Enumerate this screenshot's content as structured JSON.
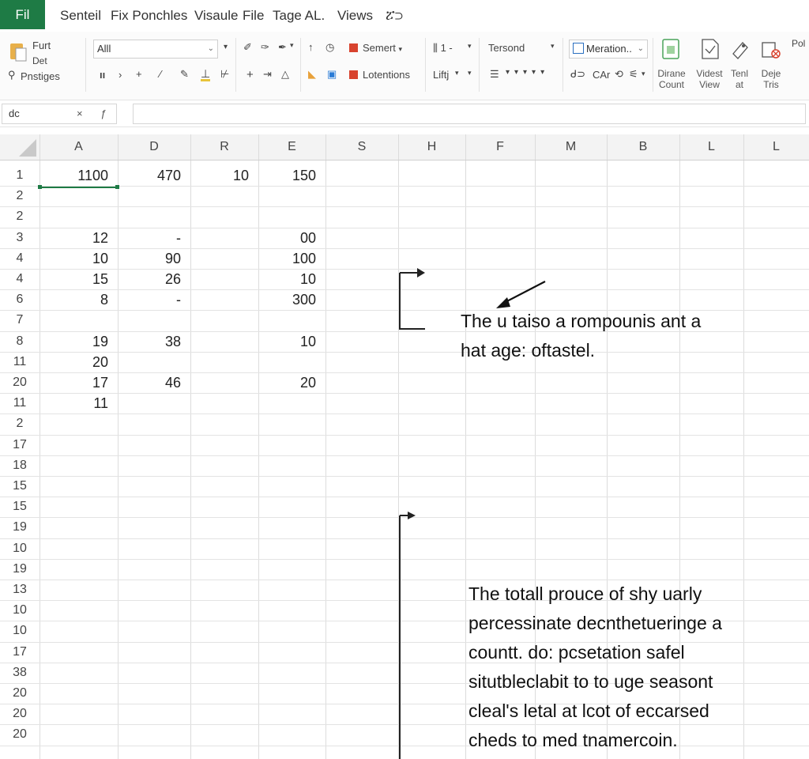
{
  "menu": {
    "file": "Fil",
    "items": [
      "Senteil",
      "Fix Ponchles",
      "Visaule",
      "File",
      "Tage AL.",
      "Views",
      "ፘ⊃"
    ]
  },
  "ribbon": {
    "clipboard": {
      "line1": "Furt",
      "line2": "Det",
      "line3": "Pnstiges"
    },
    "font_combo": "Alll",
    "insert_label": "Semert",
    "lotentions_label": "Lotentions",
    "number_group": {
      "top": "⫼ 1 -",
      "bottom": "Liftj"
    },
    "style_combo": "Tersond",
    "merge_combo": "Meration..",
    "merge_row2": "CAr",
    "right_buttons": [
      {
        "line1": "Dirane",
        "line2": "Count"
      },
      {
        "line1": "Videst",
        "line2": "View"
      },
      {
        "line1": "Tenl",
        "line2": "at"
      },
      {
        "line1": "Deje",
        "line2": "Tris"
      }
    ],
    "far_right": "Pol"
  },
  "formula_bar": {
    "name_box": "dc",
    "cancel": "×",
    "fx": "ƒ"
  },
  "columns": [
    "A",
    "D",
    "R",
    "E",
    "S",
    "H",
    "F",
    "M",
    "B",
    "L",
    "L"
  ],
  "rows": [
    {
      "n": "1",
      "a": "1100",
      "d": "470",
      "r": "10",
      "e": "150"
    },
    {
      "n": "2",
      "a": "",
      "d": "",
      "r": "",
      "e": ""
    },
    {
      "n": "2",
      "a": "",
      "d": "",
      "r": "",
      "e": ""
    },
    {
      "n": "3",
      "a": "12",
      "d": "-",
      "r": "",
      "e": "00"
    },
    {
      "n": "4",
      "a": "10",
      "d": "90",
      "r": "",
      "e": "100"
    },
    {
      "n": "4",
      "a": "15",
      "d": "26",
      "r": "",
      "e": "10"
    },
    {
      "n": "6",
      "a": "8",
      "d": "-",
      "r": "",
      "e": "300"
    },
    {
      "n": "7",
      "a": "",
      "d": "",
      "r": "",
      "e": ""
    },
    {
      "n": "8",
      "a": "19",
      "d": "38",
      "r": "",
      "e": "10"
    },
    {
      "n": "11",
      "a": "20",
      "d": "",
      "r": "",
      "e": ""
    },
    {
      "n": "20",
      "a": "17",
      "d": "46",
      "r": "",
      "e": "20"
    },
    {
      "n": "11",
      "a": "11",
      "d": "",
      "r": "",
      "e": ""
    },
    {
      "n": "2",
      "a": "",
      "d": "",
      "r": "",
      "e": ""
    },
    {
      "n": "17",
      "a": "",
      "d": "",
      "r": "",
      "e": ""
    },
    {
      "n": "18",
      "a": "",
      "d": "",
      "r": "",
      "e": ""
    },
    {
      "n": "15",
      "a": "",
      "d": "",
      "r": "",
      "e": ""
    },
    {
      "n": "15",
      "a": "",
      "d": "",
      "r": "",
      "e": ""
    },
    {
      "n": "19",
      "a": "",
      "d": "",
      "r": "",
      "e": ""
    },
    {
      "n": "10",
      "a": "",
      "d": "",
      "r": "",
      "e": ""
    },
    {
      "n": "19",
      "a": "",
      "d": "",
      "r": "",
      "e": ""
    },
    {
      "n": "13",
      "a": "",
      "d": "",
      "r": "",
      "e": ""
    },
    {
      "n": "10",
      "a": "",
      "d": "",
      "r": "",
      "e": ""
    },
    {
      "n": "10",
      "a": "",
      "d": "",
      "r": "",
      "e": ""
    },
    {
      "n": "17",
      "a": "",
      "d": "",
      "r": "",
      "e": ""
    },
    {
      "n": "38",
      "a": "",
      "d": "",
      "r": "",
      "e": ""
    },
    {
      "n": "20",
      "a": "",
      "d": "",
      "r": "",
      "e": ""
    },
    {
      "n": "20",
      "a": "",
      "d": "",
      "r": "",
      "e": ""
    },
    {
      "n": "20",
      "a": "",
      "d": "",
      "r": "",
      "e": ""
    }
  ],
  "annotations": {
    "note1": [
      "The u taiso a rompounis ant a",
      "hat age: oftastel."
    ],
    "note2": [
      "The totall prouce of shy uarly",
      "percessinate decnthetueringe a",
      "countt. do: pcsetation safel",
      "situtbleclabit to to uge seasont",
      "cleal's letal at lcot of eccarsed",
      "cheds to med tnamercoin."
    ]
  },
  "colors": {
    "file_tab": "#1e7b45",
    "selection": "#1e7b45",
    "red_icon": "#d8432e"
  }
}
